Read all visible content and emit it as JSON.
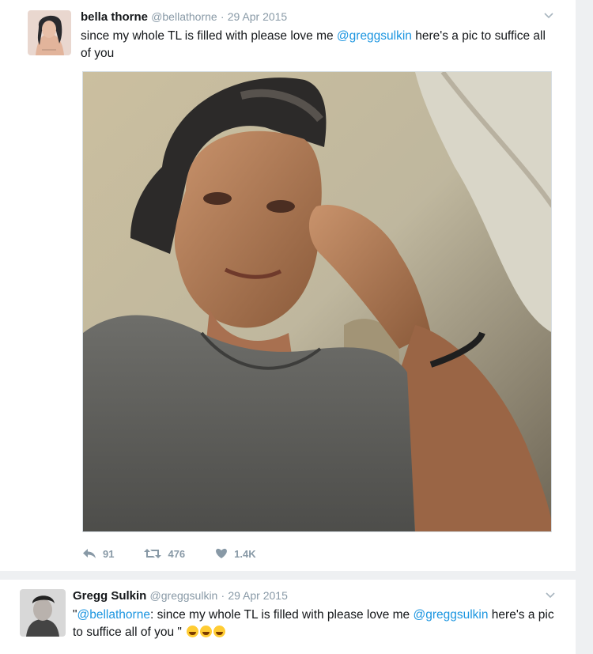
{
  "tweet1": {
    "name": "bella thorne",
    "handle": "@bellathorne",
    "separator": "·",
    "date": "29 Apr 2015",
    "text_before": "since my whole TL is filled with please love me ",
    "mention": "@greggsulkin",
    "text_after": " here's a pic to suffice all of you",
    "stats": {
      "replies": "91",
      "retweets": "476",
      "likes": "1.4K"
    }
  },
  "tweet2": {
    "name": "Gregg Sulkin",
    "handle": "@greggsulkin",
    "separator": "·",
    "date": "29 Apr 2015",
    "quote_open": "\"",
    "mention1": "@bellathorne",
    "text_middle": ": since my whole TL is filled with please love me ",
    "mention2": "@greggsulkin",
    "text_end": " here's a pic to suffice all of you \"",
    "emoji": "face-with-tears-of-joy x3"
  },
  "colors": {
    "link": "#1b95e0",
    "muted": "#8899a6",
    "background": "#eef0f2"
  }
}
